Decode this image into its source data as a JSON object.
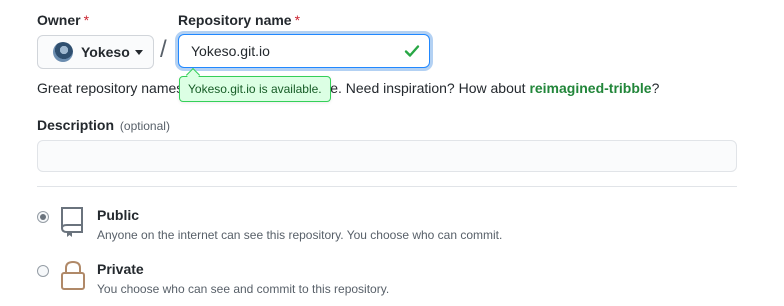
{
  "owner": {
    "label": "Owner",
    "required_mark": "*",
    "selected": "Yokeso"
  },
  "repo": {
    "label": "Repository name",
    "required_mark": "*",
    "value": "Yokeso.git.io",
    "separator": "/",
    "status_icon": "check-icon",
    "tooltip": "Yokeso.git.io is available."
  },
  "hint": {
    "prefix": "Great repository names",
    "visible_tail": "ble. Need inspiration? How about",
    "suggestion": "reimagined-tribble",
    "suffix": "?"
  },
  "description": {
    "label": "Description",
    "optional": "(optional)",
    "value": ""
  },
  "visibility": {
    "options": [
      {
        "title": "Public",
        "desc": "Anyone on the internet can see this repository. You choose who can commit.",
        "selected": true,
        "icon": "repo-icon"
      },
      {
        "title": "Private",
        "desc": "You choose who can see and commit to this repository.",
        "selected": false,
        "icon": "lock-icon"
      }
    ]
  },
  "colors": {
    "required": "#cb2431",
    "success": "#22863a",
    "focus": "#2188ff"
  }
}
